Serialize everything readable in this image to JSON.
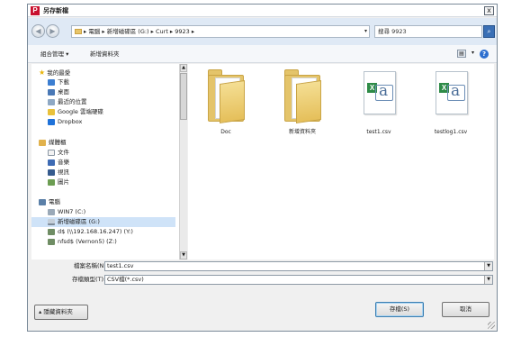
{
  "window": {
    "app_icon_letter": "P",
    "title": "另存新檔",
    "close_glyph": "x"
  },
  "address": {
    "path": "▸ 電腦 ▸ 新增磁碟區 (G:) ▸ Curt ▸ 9923 ▸",
    "dropdown_glyph": "▾"
  },
  "search": {
    "value": "搜尋 9923"
  },
  "toolbar": {
    "organize_label": "組合管理 ▾",
    "new_folder_label": "新增資料夾",
    "help_glyph": "?"
  },
  "navpane": {
    "items": [
      {
        "label": "我的最愛"
      },
      {
        "label": "下載"
      },
      {
        "label": "桌面"
      },
      {
        "label": "最近的位置"
      },
      {
        "label": "Google 雲端硬碟"
      },
      {
        "label": "Dropbox"
      },
      {
        "label": "媒體櫃"
      },
      {
        "label": "文件"
      },
      {
        "label": "音樂"
      },
      {
        "label": "視訊"
      },
      {
        "label": "圖片"
      },
      {
        "label": "電腦"
      },
      {
        "label": "WIN7 (C:)"
      },
      {
        "label": "新增磁碟區 (G:)"
      },
      {
        "label": "d$ (\\\\192.168.16.247) (Y:)"
      },
      {
        "label": "nfsd$ (Vernon5) (Z:)"
      }
    ],
    "selected_index": 13
  },
  "files": [
    {
      "name": "Doc",
      "kind": "folder"
    },
    {
      "name": "新增資料夾",
      "kind": "folder"
    },
    {
      "name": "test1.csv",
      "kind": "csv"
    },
    {
      "name": "testlog1.csv",
      "kind": "csv"
    }
  ],
  "filename": {
    "label": "檔案名稱(N):",
    "value": "test1.csv"
  },
  "filetype": {
    "label": "存檔類型(T):",
    "value": "CSV檔(*.csv)"
  },
  "buttons": {
    "hide_folders": "▴ 隱藏資料夾",
    "save": "存檔(S)",
    "cancel": "取消"
  },
  "colors": {
    "app_icon": "#c8102e",
    "selection": "#cfe3f8",
    "address_bar_bg": "#dfe9f5"
  }
}
